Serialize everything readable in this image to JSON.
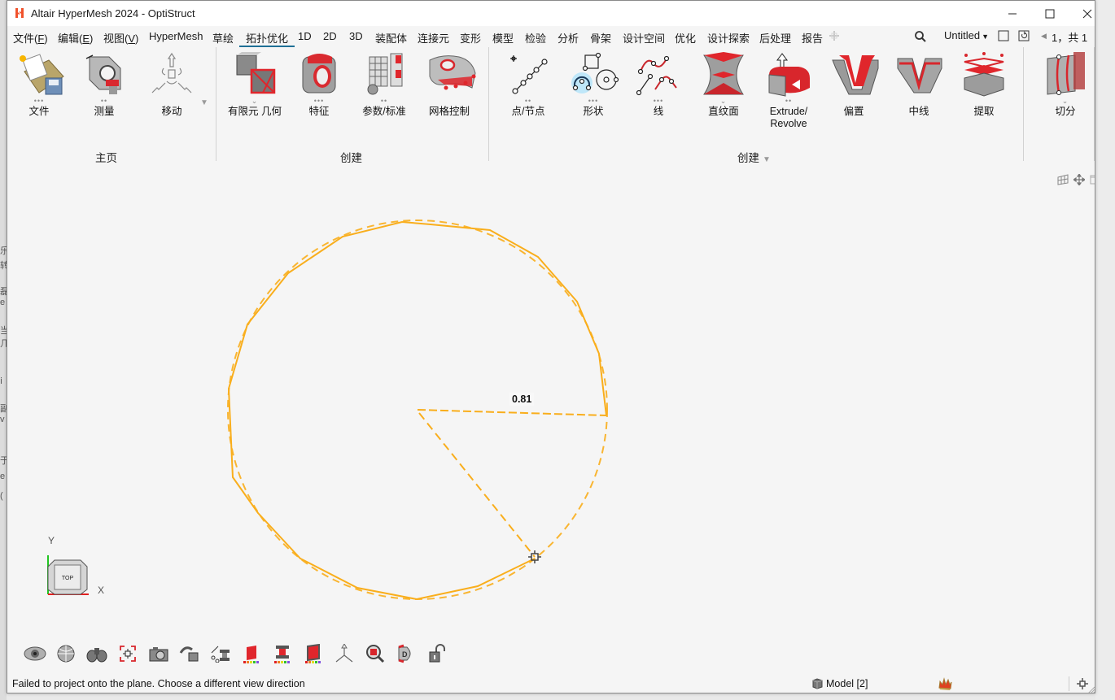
{
  "window": {
    "title": "Altair HyperMesh 2024 - OptiStruct",
    "controls": [
      "minimize",
      "maximize",
      "close"
    ]
  },
  "menubar": {
    "items": [
      {
        "label": "文件(",
        "key": "F",
        "suffix": ")"
      },
      {
        "label": "编辑(",
        "key": "E",
        "suffix": ")"
      },
      {
        "label": "视图(",
        "key": "V",
        "suffix": ")"
      },
      {
        "label": "HyperMesh"
      },
      {
        "label": "草绘"
      },
      {
        "label": "拓扑优化",
        "active": true
      },
      {
        "label": "1D"
      },
      {
        "label": "2D"
      },
      {
        "label": "3D"
      },
      {
        "label": "装配体"
      },
      {
        "label": "连接元"
      },
      {
        "label": "变形"
      },
      {
        "label": "模型"
      },
      {
        "label": "检验"
      },
      {
        "label": "分析"
      },
      {
        "label": "骨架"
      },
      {
        "label": "设计空间"
      },
      {
        "label": "优化"
      },
      {
        "label": "设计探索"
      },
      {
        "label": "后处理"
      },
      {
        "label": "报告"
      }
    ],
    "add_tab_icon": "plus-icon",
    "session_name": "Untitled",
    "page_indicator": "1，共 1"
  },
  "ribbon": {
    "groups": [
      {
        "label": "主页",
        "tools": [
          {
            "label": "文件",
            "icon": "file-folder-icon",
            "indicator": "•••"
          },
          {
            "label": "测量",
            "icon": "measure-icon",
            "indicator": "••"
          },
          {
            "label": "移动",
            "icon": "move-icon",
            "indicator": ""
          }
        ]
      },
      {
        "label": "创建",
        "tools": [
          {
            "label": "有限元 几何",
            "icon": "fe-geometry-icon",
            "indicator": "⌄"
          },
          {
            "label": "特征",
            "icon": "feature-icon",
            "indicator": "•••"
          },
          {
            "label": "参数/标准",
            "icon": "parameters-icon",
            "indicator": "••"
          },
          {
            "label": "网格控制",
            "icon": "mesh-control-icon",
            "indicator": ""
          }
        ]
      },
      {
        "label": "创建",
        "has_dropdown": true,
        "tools": [
          {
            "label": "点/节点",
            "icon": "point-node-icon",
            "indicator": "••"
          },
          {
            "label": "形状",
            "icon": "shape-icon",
            "indicator": "•••",
            "active": true
          },
          {
            "label": "线",
            "icon": "line-icon",
            "indicator": "•••"
          },
          {
            "label": "直纹面",
            "icon": "ruled-surface-icon",
            "indicator": "⌄"
          },
          {
            "label": "Extrude/\nRevolve",
            "label_line1": "Extrude/",
            "label_line2": "Revolve",
            "icon": "extrude-revolve-icon",
            "indicator": "••"
          },
          {
            "label": "偏置",
            "icon": "offset-icon",
            "indicator": ""
          },
          {
            "label": "中线",
            "icon": "midline-icon",
            "indicator": ""
          },
          {
            "label": "提取",
            "icon": "extract-icon",
            "indicator": ""
          }
        ]
      },
      {
        "label": "",
        "tools": [
          {
            "label": "切分",
            "icon": "split-icon",
            "indicator": "⌄"
          }
        ]
      }
    ]
  },
  "viewport": {
    "measure_value": "0.81",
    "sketch_color": "#f9ae1c",
    "view_cube_label": "TOP",
    "axis_labels": {
      "x": "X",
      "y": "Y"
    },
    "corner_icons": [
      "grid-icon",
      "pan-icon",
      "window-icon"
    ],
    "bottom_tools": [
      "visibility-eye-icon",
      "globe-view-icon",
      "binoculars-icon",
      "fit-view-icon",
      "camera-icon",
      "rotate-cube-icon",
      "section-cut-icon",
      "contour-red-icon",
      "element-red-icon",
      "shade-red-icon",
      "triad-icon",
      "zoom-box-icon",
      "3d-view-icon",
      "unlock-icon"
    ]
  },
  "statusbar": {
    "message": "Failed to project onto the plane. Choose a different view direction",
    "model_label": "Model [2]",
    "fire_icon": "crown-fire-icon",
    "snap_icon": "crosshair-icon"
  }
}
